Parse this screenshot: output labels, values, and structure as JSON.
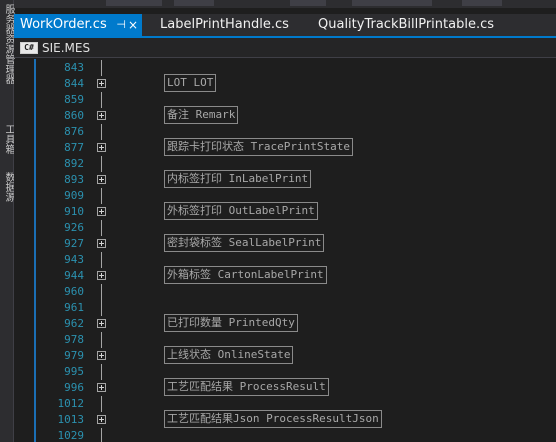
{
  "side_panel": {
    "labels": [
      "服务器资源管理器",
      "工具箱",
      "数据源"
    ]
  },
  "tabs": [
    {
      "label": "WorkOrder.cs",
      "active": true,
      "pin": "⊣",
      "close": "×"
    },
    {
      "label": "LabelPrintHandle.cs",
      "active": false
    },
    {
      "label": "QualityTrackBillPrintable.cs",
      "active": false
    }
  ],
  "navbar": {
    "project_icon": "C#",
    "project_name": "SIE.MES"
  },
  "editor": {
    "lines": [
      {
        "num": "843",
        "collapsed": null
      },
      {
        "num": "844",
        "collapsed": "LOT LOT"
      },
      {
        "num": "859",
        "collapsed": null
      },
      {
        "num": "860",
        "collapsed": "备注 Remark"
      },
      {
        "num": "876",
        "collapsed": null
      },
      {
        "num": "877",
        "collapsed": "跟踪卡打印状态 TracePrintState"
      },
      {
        "num": "892",
        "collapsed": null
      },
      {
        "num": "893",
        "collapsed": "内标签打印 InLabelPrint"
      },
      {
        "num": "909",
        "collapsed": null
      },
      {
        "num": "910",
        "collapsed": "外标签打印 OutLabelPrint"
      },
      {
        "num": "926",
        "collapsed": null
      },
      {
        "num": "927",
        "collapsed": "密封袋标签 SealLabelPrint"
      },
      {
        "num": "943",
        "collapsed": null
      },
      {
        "num": "944",
        "collapsed": "外箱标签 CartonLabelPrint"
      },
      {
        "num": "960",
        "collapsed": null
      },
      {
        "num": "961",
        "collapsed": null
      },
      {
        "num": "962",
        "collapsed": "已打印数量 PrintedQty"
      },
      {
        "num": "978",
        "collapsed": null
      },
      {
        "num": "979",
        "collapsed": "上线状态 OnlineState"
      },
      {
        "num": "995",
        "collapsed": null
      },
      {
        "num": "996",
        "collapsed": "工艺匹配结果 ProcessResult"
      },
      {
        "num": "1012",
        "collapsed": null
      },
      {
        "num": "1013",
        "collapsed": "工艺匹配结果Json ProcessResultJson"
      },
      {
        "num": "1029",
        "collapsed": null
      }
    ]
  },
  "colors": {
    "accent": "#007acc",
    "line_number": "#2b91af",
    "collapsed_text": "#a8a8a8",
    "background": "#1e1e1e"
  }
}
